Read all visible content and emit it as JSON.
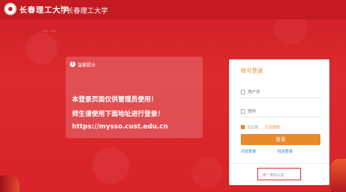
{
  "header": {
    "logo_text": "长春理工大学",
    "link_label": "长春理工大学"
  },
  "notice": {
    "header_label": "温馨提示",
    "line1": "本登录页面仅供管理员使用！",
    "line2": "师生请使用下面地址进行登录！",
    "line3": "https://mysso.cust.edu.cn"
  },
  "login": {
    "title": "账号登录",
    "username_placeholder": "用户名",
    "password_placeholder": "密码",
    "remember_label": "记住我",
    "forgot_label": "忘记密码",
    "submit_label": "登录",
    "alt_left": "扫码登录",
    "alt_right": "短信登录",
    "bottom_link": "统一身份认证"
  },
  "colors": {
    "background": "#d9232a",
    "accent": "#e8892c",
    "link": "#4a7bd0"
  }
}
